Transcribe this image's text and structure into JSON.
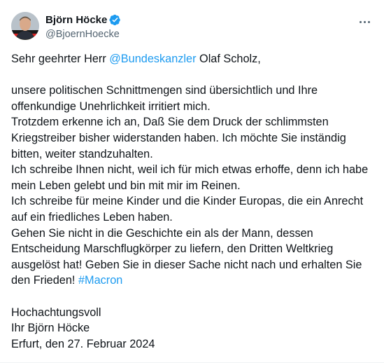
{
  "author": {
    "display_name": "Björn Höcke",
    "handle": "@BjoernHoecke"
  },
  "icons": {
    "verified": "verified-badge-icon",
    "more": "more-options-icon"
  },
  "colors": {
    "link": "#1d9bf0",
    "text": "#0f1419",
    "secondary": "#536471",
    "verified": "#1d9bf0"
  },
  "tweet": {
    "l1_pre": "Sehr geehrter Herr ",
    "mention": "@Bundeskanzler",
    "l1_post": " Olaf Scholz,",
    "l2": "unsere politischen Schnittmengen sind übersichtlich und Ihre",
    "l3": "offenkundige Unehrlichkeit irritiert mich.",
    "l4": "Trotzdem erkenne ich an, Daß Sie dem Druck der schlimmsten",
    "l5": "Kriegstreiber bisher widerstanden haben. Ich möchte Sie inständig",
    "l6": "bitten, weiter standzuhalten.",
    "l7": "Ich schreibe Ihnen nicht, weil ich für mich etwas erhoffe, denn ich habe",
    "l8": "mein Leben gelebt und bin mit mir im Reinen.",
    "l9": "Ich schreibe für meine Kinder und die Kinder Europas, die ein Anrecht",
    "l10": "auf ein friedliches Leben haben.",
    "l11": "Gehen Sie nicht in die Geschichte ein als der Mann, dessen",
    "l12": "Entscheidung Marschflugkörper zu liefern, den Dritten Weltkrieg",
    "l13": "ausgelöst hat! Geben Sie in dieser Sache nicht nach und erhalten Sie",
    "l14_pre": "den Frieden! ",
    "hashtag": "#Macron",
    "l15": "Hochachtungsvoll",
    "l16": "Ihr Björn Höcke",
    "l17": "Erfurt, den 27. Februar 2024"
  }
}
